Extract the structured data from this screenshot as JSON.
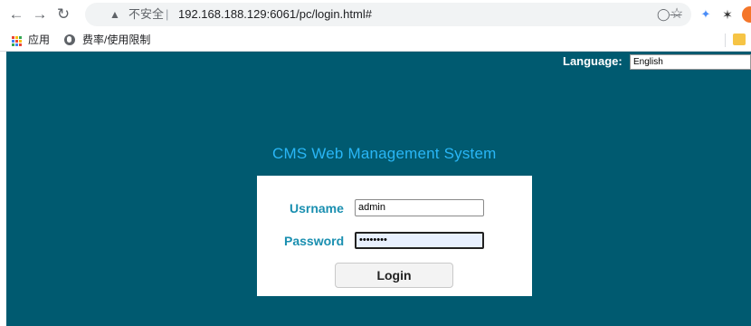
{
  "browser": {
    "security_label": "不安全",
    "separator": "|",
    "url": "192.168.188.129:6061/pc/login.html#",
    "bookmarks": [
      {
        "icon": "apps-grid-icon",
        "label": "应用"
      },
      {
        "icon": "globe-icon",
        "label": "费率/使用限制"
      }
    ]
  },
  "header": {
    "language_label": "Language:",
    "language_value": "English"
  },
  "login": {
    "title": "CMS Web Management System",
    "username_label": "Usrname",
    "username_value": "admin",
    "password_label": "Password",
    "password_value": "••••••••",
    "submit_label": "Login"
  },
  "colors": {
    "page_background": "#005a70",
    "title": "#29b6f6",
    "field_label": "#1a8fb0"
  }
}
